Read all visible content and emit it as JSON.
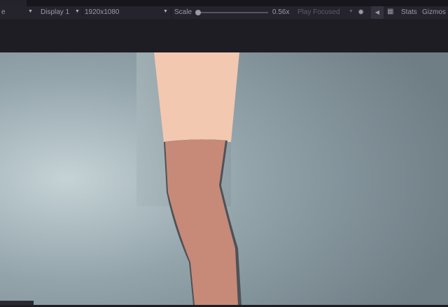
{
  "toolbar": {
    "view_label": "e",
    "display": "Display 1",
    "resolution": "1920x1080",
    "scale_label": "Scale",
    "scale_value": "0.56x",
    "scale_fraction": 0.0,
    "play_mode": "Play Focused",
    "stats": "Stats",
    "gizmos": "Gizmos",
    "icons": [
      "bug-icon",
      "audio-mute-icon",
      "keyboard-icon"
    ]
  }
}
